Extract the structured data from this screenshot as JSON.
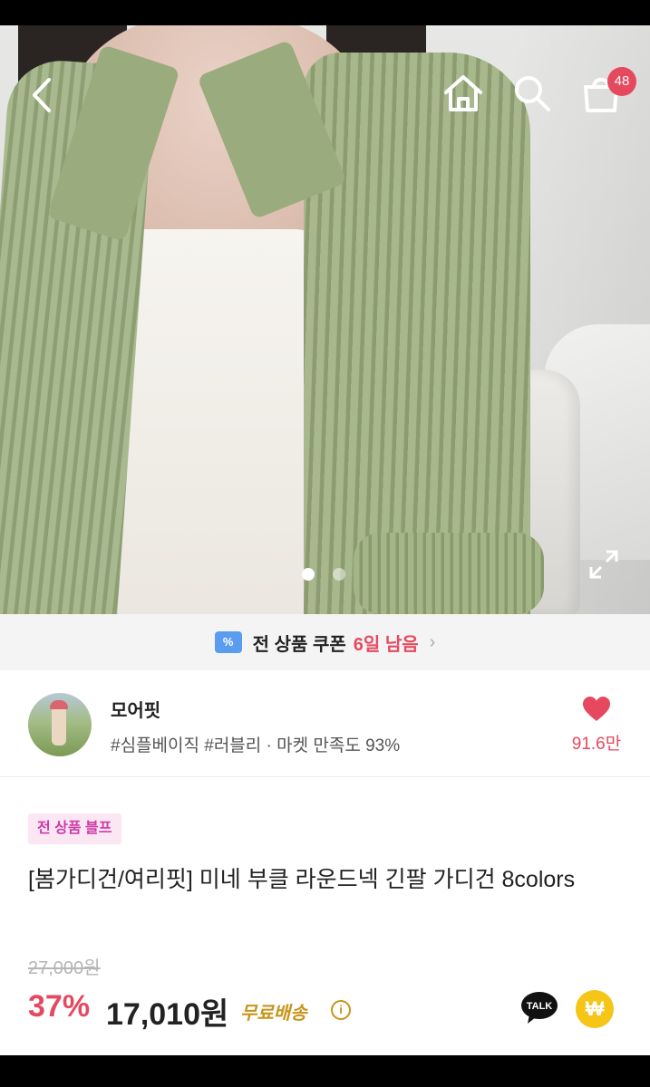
{
  "header": {
    "cart_count": "48"
  },
  "gallery": {
    "current_index": 1,
    "total": 2
  },
  "coupon": {
    "text": "전 상품 쿠폰",
    "days_left": "6일 남음"
  },
  "store": {
    "name": "모어핏",
    "tags": "#심플베이직 #러블리 · 마켓 만족도 93%",
    "likes": "91.6만"
  },
  "product": {
    "badge": "전 상품 블프",
    "title": "[봄가디건/여리핏] 미네 부클 라운드넥 긴팔 가디건 8colors",
    "original_price": "27,000원",
    "discount": "37%",
    "price": "17,010원",
    "shipping": "무료배송"
  },
  "colors": {
    "accent_red": "#e5495f",
    "badge_pink": "#cc3ca7",
    "shipping_gold": "#c8941a",
    "pay_yellow": "#f5c518"
  },
  "icons": [
    "back-icon",
    "home-icon",
    "search-icon",
    "cart-icon",
    "expand-icon",
    "coupon-icon",
    "chevron-right-icon",
    "heart-icon",
    "info-icon",
    "kakaotalk-icon",
    "pay-won-icon"
  ]
}
